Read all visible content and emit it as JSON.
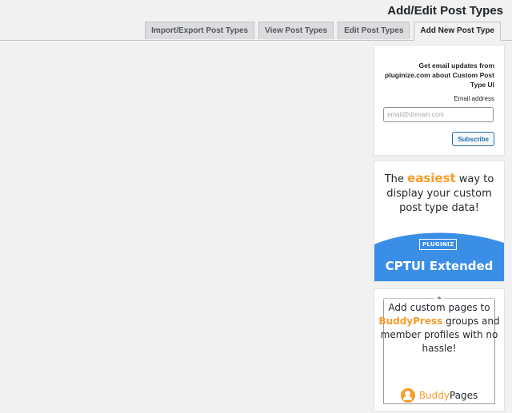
{
  "header": {
    "title": "Add/Edit Post Types"
  },
  "tabs": [
    {
      "label": "Import/Export Post Types",
      "active": false
    },
    {
      "label": "View Post Types",
      "active": false
    },
    {
      "label": "Edit Post Types",
      "active": false
    },
    {
      "label": "Add New Post Type",
      "active": true
    }
  ],
  "sidebar": {
    "newsletter": {
      "title": "Get email updates from pluginize.com about Custom Post Type UI",
      "email_label": "Email address",
      "email_placeholder": "email@domain.com",
      "email_value": "",
      "subscribe_label": "Subscribe"
    },
    "promo_extended": {
      "headline_before": "The ",
      "headline_highlight": "easiest",
      "headline_after": " way to display your custom post type data!",
      "logo_text": "PLUGINIZ",
      "product_name": "CPTUI Extended"
    },
    "promo_buddypages": {
      "text_before": "Add custom pages to ",
      "text_highlight": "BuddyPress",
      "text_after": " groups and member profiles with no hassle!",
      "brand_part1": "Buddy",
      "brand_part2": "Pages"
    }
  },
  "colors": {
    "accent": "#2271b1",
    "highlight": "#f99b2a",
    "promo_blue": "#3a8ee6"
  }
}
